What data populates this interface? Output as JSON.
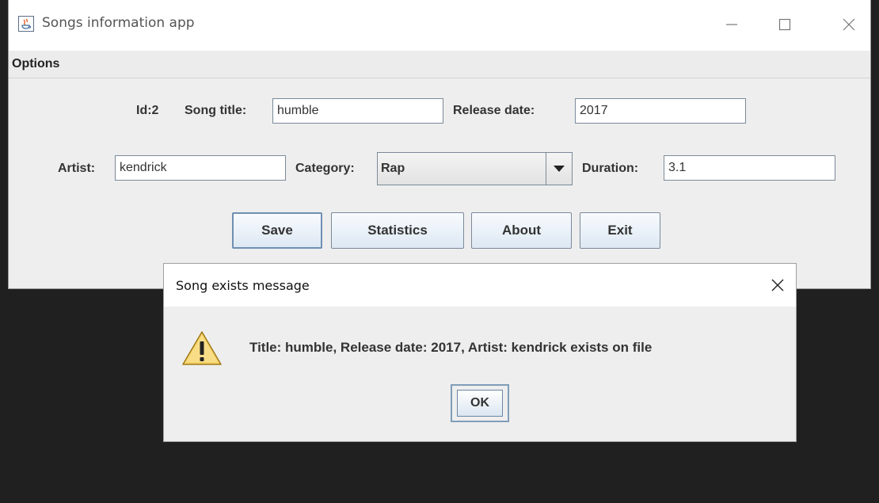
{
  "window": {
    "title": "Songs information app",
    "icon": "java-icon"
  },
  "menu": {
    "options_label": "Options"
  },
  "form": {
    "id_label": "Id:2",
    "song_title_label": "Song title:",
    "song_title_value": "humble",
    "release_date_label": "Release date:",
    "release_date_value": "2017",
    "artist_label": "Artist:",
    "artist_value": "kendrick",
    "category_label": "Category:",
    "category_value": "Rap",
    "duration_label": "Duration:",
    "duration_value": "3.1"
  },
  "buttons": {
    "save": "Save",
    "statistics": "Statistics",
    "about": "About",
    "exit": "Exit"
  },
  "dialog": {
    "title": "Song exists message",
    "message": "Title: humble, Release date: 2017, Artist: kendrick exists on file",
    "ok_label": "OK",
    "icon": "warning-icon"
  },
  "colors": {
    "window_bg": "#eeeeee",
    "title_bar_bg": "#ffffff",
    "button_gradient_top": "#f8fbfe",
    "button_gradient_bottom": "#dde8f3",
    "field_border": "#7a8a99",
    "backdrop": "#202020",
    "warning_yellow": "#f5d36a"
  }
}
